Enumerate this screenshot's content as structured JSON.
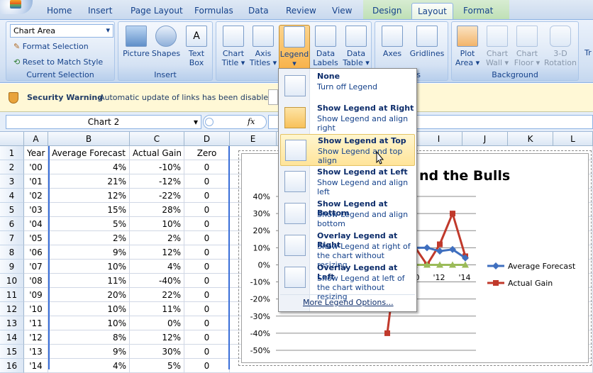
{
  "ribbon": {
    "tabs": [
      "Home",
      "Insert",
      "Page Layout",
      "Formulas",
      "Data",
      "Review",
      "View",
      "Design",
      "Layout",
      "Format"
    ],
    "active_tab": "Layout",
    "chart_element_selector": "Chart Area",
    "format_selection": "Format Selection",
    "reset_to_match_style": "Reset to Match Style",
    "current_selection_label": "Current Selection",
    "insert_group": {
      "label": "Insert",
      "picture": "Picture",
      "shapes": "Shapes",
      "text_box_1": "Text",
      "text_box_2": "Box"
    },
    "labels_buttons": [
      {
        "l1": "Chart",
        "l2": "Title ▾"
      },
      {
        "l1": "Axis",
        "l2": "Titles ▾"
      },
      {
        "l1": "Legend",
        "l2": "▾"
      },
      {
        "l1": "Data",
        "l2": "Labels ▾"
      },
      {
        "l1": "Data",
        "l2": "Table ▾"
      }
    ],
    "axes_group": {
      "axes": "Axes",
      "gridlines": "Gridlines",
      "label": "s"
    },
    "background_group": {
      "label": "Background",
      "plot_area_1": "Plot",
      "plot_area_2": "Area ▾",
      "chart_wall_1": "Chart",
      "chart_wall_2": "Wall ▾",
      "chart_floor_1": "Chart",
      "chart_floor_2": "Floor ▾",
      "rotation_1": "3-D",
      "rotation_2": "Rotation"
    },
    "cut_off": "Tr"
  },
  "security": {
    "title": "Security Warning",
    "message": "Automatic update of links has been disabled"
  },
  "formula_bar": {
    "name_box": "Chart 2",
    "fx": "fx"
  },
  "sheet": {
    "columns": [
      "A",
      "B",
      "C",
      "D",
      "E",
      "F",
      "G",
      "H",
      "I",
      "J",
      "K",
      "L"
    ],
    "rows": [
      [
        "Year",
        "Average Forecast",
        "Actual Gain",
        "Zero"
      ],
      [
        "'00",
        "4%",
        "-10%",
        "0"
      ],
      [
        "'01",
        "21%",
        "-12%",
        "0"
      ],
      [
        "'02",
        "12%",
        "-22%",
        "0"
      ],
      [
        "'03",
        "15%",
        "28%",
        "0"
      ],
      [
        "'04",
        "5%",
        "10%",
        "0"
      ],
      [
        "'05",
        "2%",
        "2%",
        "0"
      ],
      [
        "'06",
        "9%",
        "12%",
        "0"
      ],
      [
        "'07",
        "10%",
        "4%",
        "0"
      ],
      [
        "'08",
        "11%",
        "-40%",
        "0"
      ],
      [
        "'09",
        "20%",
        "22%",
        "0"
      ],
      [
        "'10",
        "10%",
        "11%",
        "0"
      ],
      [
        "'11",
        "10%",
        "0%",
        "0"
      ],
      [
        "'12",
        "8%",
        "12%",
        "0"
      ],
      [
        "'13",
        "9%",
        "30%",
        "0"
      ],
      [
        "'14",
        "4%",
        "5%",
        "0"
      ]
    ]
  },
  "legend_menu": {
    "items": [
      {
        "title": "None",
        "desc": "Turn off Legend"
      },
      {
        "title": "Show Legend at Right",
        "desc": "Show Legend and align right"
      },
      {
        "title": "Show Legend at Top",
        "desc": "Show Legend and top align"
      },
      {
        "title": "Show Legend at Left",
        "desc": "Show Legend and align left"
      },
      {
        "title": "Show Legend at Bottom",
        "desc": "Show Legend and align bottom"
      },
      {
        "title": "Overlay Legend at Right",
        "desc": "Show Legend at right of the chart without resizing"
      },
      {
        "title": "Overlay Legend at Left",
        "desc": "Show Legend at left of the chart without resizing"
      }
    ],
    "more": "More Legend Options..."
  },
  "chart_data": {
    "type": "line",
    "title": "nd the Bulls",
    "visible_x_ticks": [
      "0",
      "'12",
      "'14"
    ],
    "ylim": [
      -0.5,
      0.4
    ],
    "y_ticks": [
      "40%",
      "30%",
      "20%",
      "10%",
      "0%",
      "-10%",
      "-20%",
      "-30%",
      "-40%",
      "-50%"
    ],
    "legend_placement": "right",
    "series": [
      {
        "name": "Average Forecast",
        "color": "#3f6fbf",
        "marker": "diamond"
      },
      {
        "name": "Actual Gain",
        "color": "#c0392b",
        "marker": "square"
      },
      {
        "name": "",
        "color": "#9bbb59",
        "marker": "triangle"
      }
    ]
  }
}
